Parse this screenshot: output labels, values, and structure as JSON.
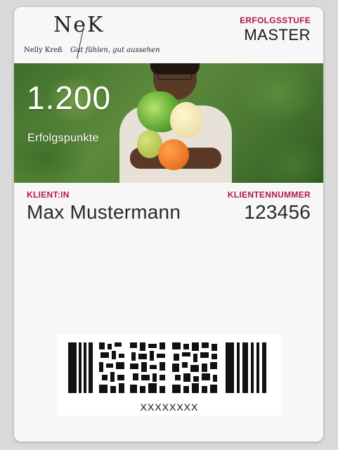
{
  "brand": {
    "logo_mark": "NeK",
    "name": "Nelly Kreß",
    "tagline": "Gut fühlen, gut aussehen"
  },
  "header": {
    "tier_label": "ERFOLGSSTUFE",
    "tier_value": "MASTER"
  },
  "strip": {
    "points_value": "1.200",
    "points_label": "Erfolgspunkte"
  },
  "fields": {
    "client_label": "KLIENT:IN",
    "client_value": "Max Mustermann",
    "client_number_label": "KLIENTENNUMMER",
    "client_number_value": "123456"
  },
  "barcode": {
    "text": "XXXXXXXX",
    "icon": "barcode-icon"
  },
  "colors": {
    "label_accent": "#b0194a",
    "pass_background": "#f7f7f7"
  }
}
